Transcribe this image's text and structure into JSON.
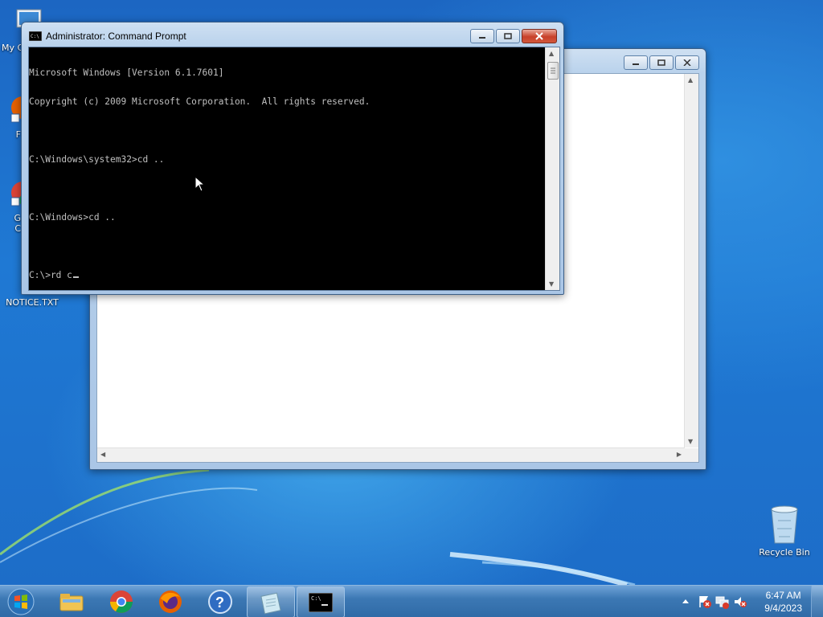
{
  "desktop": {
    "icons": [
      {
        "label": "My C"
      },
      {
        "label": "F"
      },
      {
        "label": "G"
      },
      {
        "label": "C"
      },
      {
        "label": "NOTICE.TXT"
      },
      {
        "label": "Recycle Bin"
      }
    ]
  },
  "cmd_window": {
    "title": "Administrator: Command Prompt",
    "lines": [
      "Microsoft Windows [Version 6.1.7601]",
      "Copyright (c) 2009 Microsoft Corporation.  All rights reserved.",
      "",
      "C:\\Windows\\system32>cd ..",
      "",
      "C:\\Windows>cd ..",
      "",
      "C:\\>rd c"
    ]
  },
  "taskbar": {
    "apps": [
      {
        "name": "windows-explorer"
      },
      {
        "name": "google-chrome"
      },
      {
        "name": "firefox"
      },
      {
        "name": "help"
      },
      {
        "name": "notepad"
      },
      {
        "name": "command-prompt"
      }
    ],
    "clock": {
      "time": "6:47 AM",
      "date": "9/4/2023"
    }
  },
  "colors": {
    "console_bg": "#000000",
    "console_fg": "#c0c0c0",
    "taskbar": "#2f6aa6",
    "desktop": "#1c66c2"
  }
}
